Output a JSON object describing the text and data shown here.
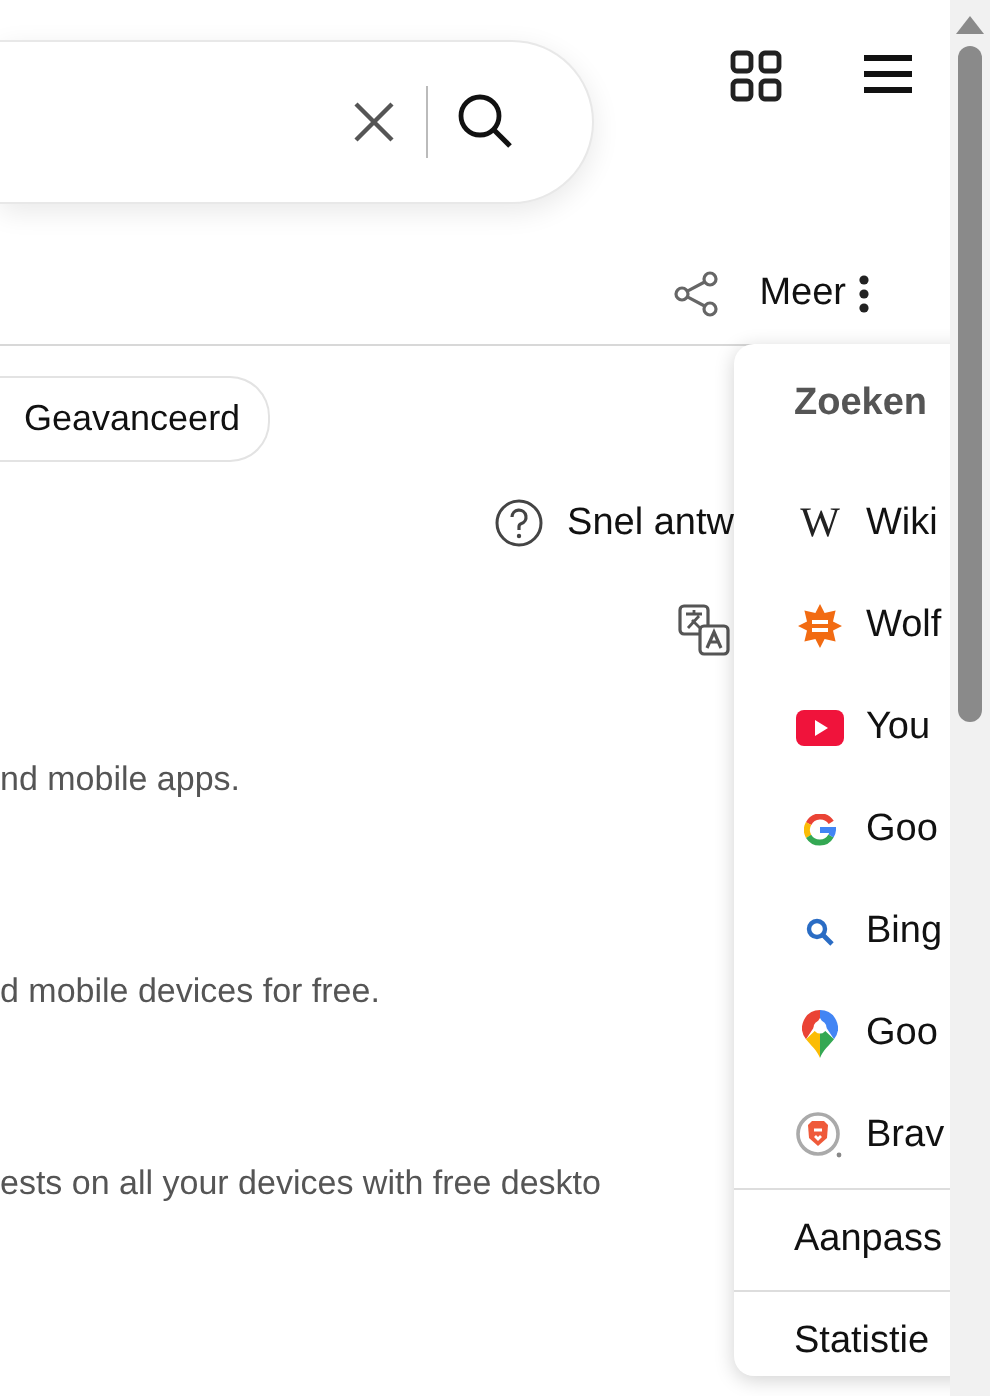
{
  "toolbar": {
    "more_label": "Meer"
  },
  "filters": [
    {
      "label": "Geavanceerd"
    }
  ],
  "quick_answer": {
    "label": "Snel antw"
  },
  "snippets": [
    "nd mobile apps.",
    "d mobile devices for free.",
    "ests on all your devices with free deskto"
  ],
  "menu": {
    "heading": "Zoeken",
    "engines": [
      {
        "kind": "wikipedia",
        "glyph": "W",
        "label": "Wiki"
      },
      {
        "kind": "wolfram",
        "label": "Wolf"
      },
      {
        "kind": "youtube",
        "label": "You"
      },
      {
        "kind": "google",
        "label": "Goo"
      },
      {
        "kind": "bing",
        "label": "Bing"
      },
      {
        "kind": "maps",
        "label": "Goo"
      },
      {
        "kind": "brave",
        "label": "Brav"
      }
    ],
    "footer": [
      "Aanpass",
      "Statistie"
    ]
  }
}
